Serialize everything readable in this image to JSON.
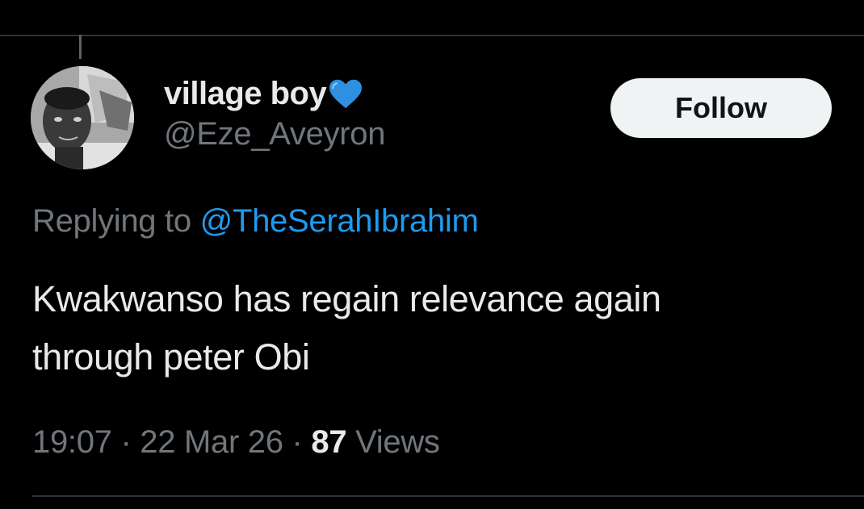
{
  "tweet": {
    "author": {
      "display_name": "village boy",
      "badge_icon": "blue-heart-icon",
      "badge_color": "#2f8fe0",
      "handle": "@Eze_Aveyron"
    },
    "follow_label": "Follow",
    "reply": {
      "prefix": "Replying to",
      "handle": "@TheSerahIbrahim"
    },
    "text": "Kwakwanso has regain relevance again\nthrough peter Obi",
    "meta": {
      "time": "19:07",
      "separator": "·",
      "date": "22 Mar 26",
      "views_count": "87",
      "views_label": "Views"
    }
  },
  "colors": {
    "background": "#000000",
    "primary_text": "#e7e9ea",
    "secondary_text": "#71767b",
    "link": "#1d9bf0",
    "divider": "#2f3336",
    "button_bg": "#eff3f4",
    "button_text": "#0f1419"
  }
}
